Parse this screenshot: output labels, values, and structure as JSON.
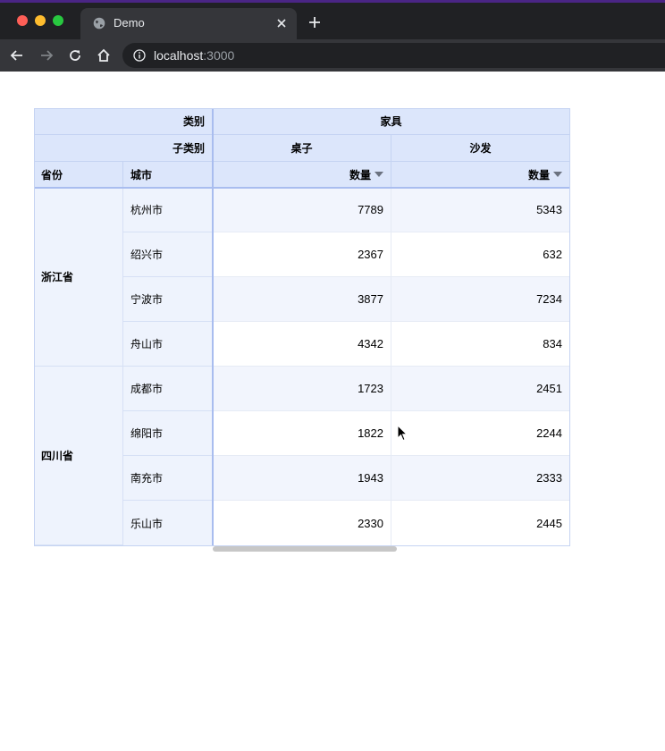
{
  "browser": {
    "tab_title": "Demo",
    "url_host": "localhost",
    "url_port": ":3000"
  },
  "pivot": {
    "corner": {
      "category_label": "类别",
      "subcategory_label": "子类别",
      "province_label": "省份",
      "city_label": "城市"
    },
    "column_header": {
      "category": "家具",
      "subcategories": [
        "桌子",
        "沙发"
      ],
      "measure": "数量"
    },
    "rows": [
      {
        "province": "浙江省",
        "cities": [
          {
            "city": "杭州市",
            "values": [
              "7789",
              "5343"
            ]
          },
          {
            "city": "绍兴市",
            "values": [
              "2367",
              "632"
            ]
          },
          {
            "city": "宁波市",
            "values": [
              "3877",
              "7234"
            ]
          },
          {
            "city": "舟山市",
            "values": [
              "4342",
              "834"
            ]
          }
        ]
      },
      {
        "province": "四川省",
        "cities": [
          {
            "city": "成都市",
            "values": [
              "1723",
              "2451"
            ]
          },
          {
            "city": "绵阳市",
            "values": [
              "1822",
              "2244"
            ]
          },
          {
            "city": "南充市",
            "values": [
              "1943",
              "2333"
            ]
          },
          {
            "city": "乐山市",
            "values": [
              "2330",
              "2445"
            ]
          }
        ]
      }
    ]
  },
  "colors": {
    "header_bg": "#dce6fb",
    "row_header_bg": "#eef3fd",
    "stripe_bg": "#f2f5fd",
    "frozen_line": "#a9bdef"
  }
}
